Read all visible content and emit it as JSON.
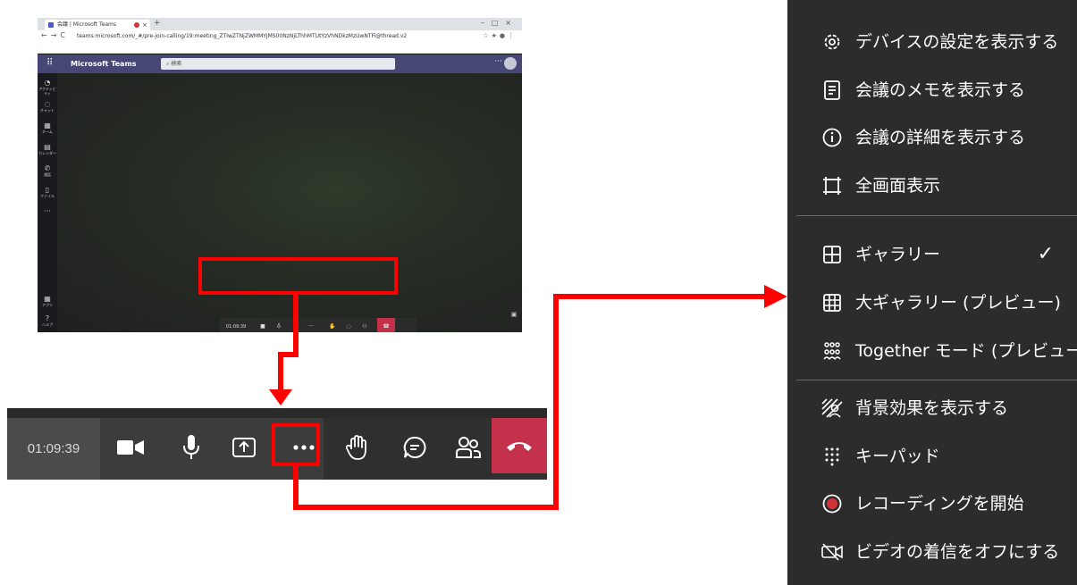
{
  "colors": {
    "highlight": "#ff0000",
    "teams_header": "#464775",
    "hangup": "#c4314b",
    "menu_bg": "#2d2c2c",
    "record_dot": "#d13438"
  },
  "browser": {
    "tab_title": "会議 | Microsoft Teams",
    "new_tab": "+",
    "url": "teams.microsoft.com/_#/pre-join-calling/19:meeting_ZTIwZTNjZWMMYjMS00NzNjLThhMTUtYzVhNDkzMzUwNTFi@thread.v2",
    "app_name": "Microsoft Teams",
    "search_placeholder": "検索",
    "more_label": "···",
    "rail_items": [
      {
        "icon": "bell-icon",
        "label": "アクティビティ"
      },
      {
        "icon": "chat-icon",
        "label": "チャット"
      },
      {
        "icon": "teams-icon",
        "label": "チーム"
      },
      {
        "icon": "calendar-icon",
        "label": "カレンダー"
      },
      {
        "icon": "phone-icon",
        "label": "通話"
      },
      {
        "icon": "file-icon",
        "label": "ファイル"
      },
      {
        "icon": "more-icon",
        "label": "···"
      },
      {
        "icon": "apps-icon",
        "label": "アプリ"
      },
      {
        "icon": "help-icon",
        "label": "ヘルプ"
      }
    ],
    "mini_timer": "01:09:39"
  },
  "callbar": {
    "timer": "01:09:39",
    "buttons": [
      {
        "name": "camera-button",
        "icon": "video-camera-icon"
      },
      {
        "name": "mic-button",
        "icon": "microphone-icon"
      },
      {
        "name": "share-button",
        "icon": "share-screen-icon"
      },
      {
        "name": "more-actions-button",
        "icon": "more-dots-icon"
      },
      {
        "name": "raise-hand-button",
        "icon": "hand-icon"
      },
      {
        "name": "chat-button",
        "icon": "chat-bubble-icon"
      },
      {
        "name": "participants-button",
        "icon": "people-icon"
      },
      {
        "name": "hang-up-button",
        "icon": "phone-hangup-icon"
      }
    ]
  },
  "menu": {
    "items": [
      {
        "label": "デバイスの設定を表示する",
        "icon": "gear-icon"
      },
      {
        "label": "会議のメモを表示する",
        "icon": "notes-icon"
      },
      {
        "label": "会議の詳細を表示する",
        "icon": "info-icon"
      },
      {
        "label": "全画面表示",
        "icon": "fullscreen-icon"
      },
      {
        "label": "ギャラリー",
        "icon": "gallery-icon",
        "checked": true,
        "check_mark": "✓"
      },
      {
        "label": "大ギャラリー (プレビュー)",
        "icon": "large-gallery-icon"
      },
      {
        "label": "Together モード (プレビュー)",
        "icon": "together-mode-icon"
      },
      {
        "label": "背景効果を表示する",
        "icon": "background-effects-icon"
      },
      {
        "label": "キーパッド",
        "icon": "keypad-icon"
      },
      {
        "label": "レコーディングを開始",
        "icon": "record-icon",
        "highlighted": true
      },
      {
        "label": "ビデオの着信をオフにする",
        "icon": "video-off-icon"
      }
    ]
  }
}
